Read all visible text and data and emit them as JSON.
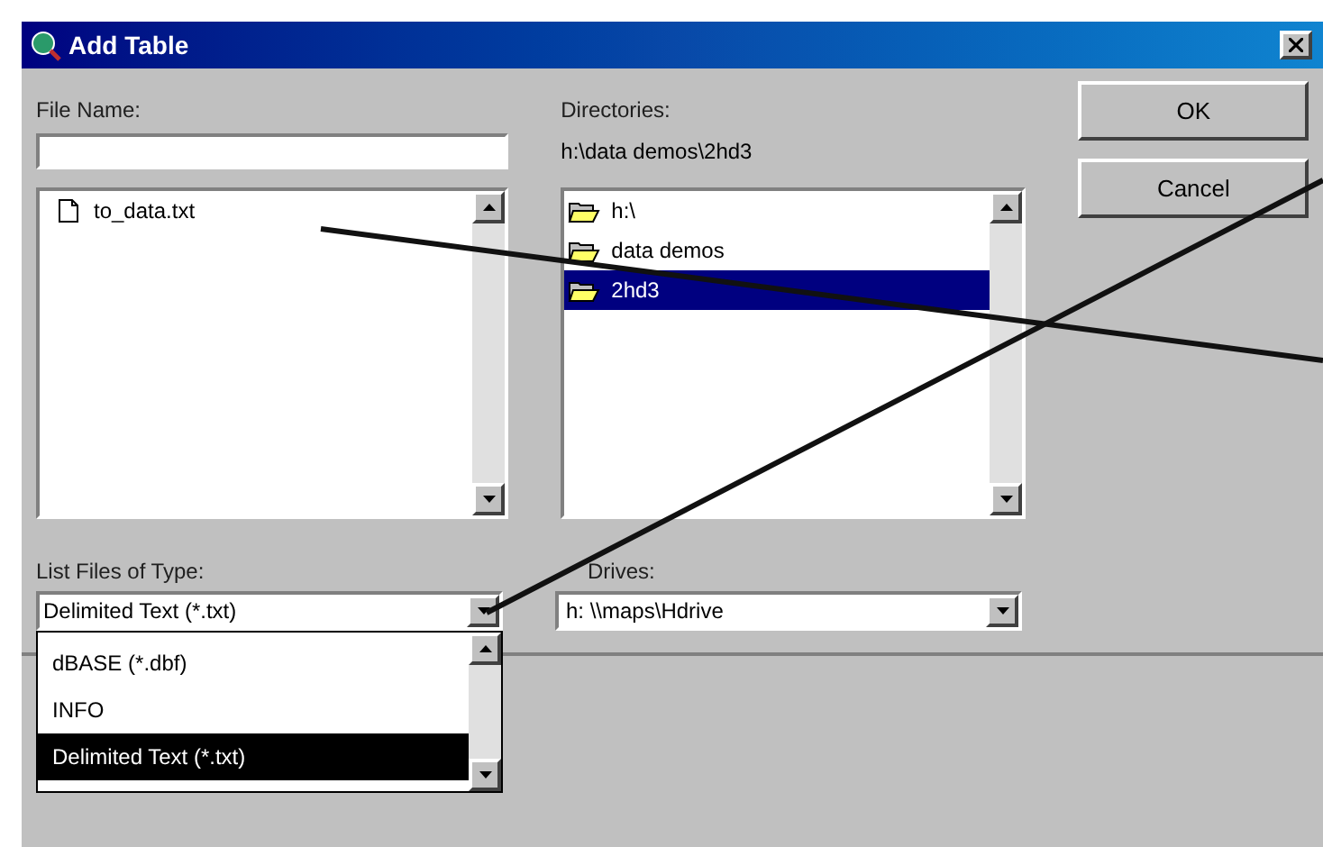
{
  "window": {
    "title": "Add Table"
  },
  "file_name": {
    "label": "File Name:"
  },
  "files": [
    {
      "name": "to_data.txt",
      "selected": false
    }
  ],
  "directories": {
    "label": "Directories:",
    "path": "h:\\data demos\\2hd3",
    "items": [
      {
        "name": "h:\\",
        "selected": false
      },
      {
        "name": "data demos",
        "selected": false
      },
      {
        "name": "2hd3",
        "selected": true
      }
    ]
  },
  "buttons": [
    "OK",
    "Cancel"
  ],
  "file_type": {
    "label": "List Files of Type:",
    "value": "Delimited Text (*.txt)",
    "expanded": true,
    "options": [
      {
        "label": "dBASE (*.dbf)",
        "selected": false
      },
      {
        "label": "INFO",
        "selected": false
      },
      {
        "label": "Delimited Text (*.txt)",
        "selected": true
      }
    ]
  },
  "drives": {
    "label": "Drives:",
    "value": "h: \\\\maps\\Hdrive"
  }
}
